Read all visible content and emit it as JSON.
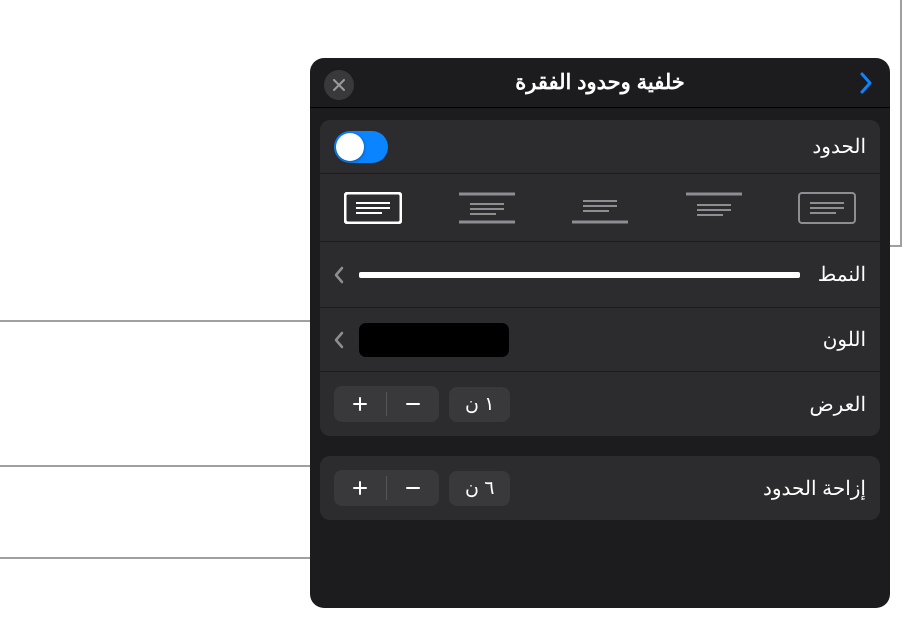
{
  "titlebar": {
    "title": "خلفية وحدود الفقرة"
  },
  "borders": {
    "label": "الحدود",
    "enabled": true
  },
  "style": {
    "label": "النمط"
  },
  "color": {
    "label": "اللون",
    "value": "#000000"
  },
  "width": {
    "label": "العرض",
    "value": "١ ن"
  },
  "offset": {
    "label": "إزاحة الحدود",
    "value": "٦ ن"
  },
  "icons": {
    "close": "close-icon",
    "back": "back-icon",
    "plus": "+",
    "minus": "−"
  }
}
